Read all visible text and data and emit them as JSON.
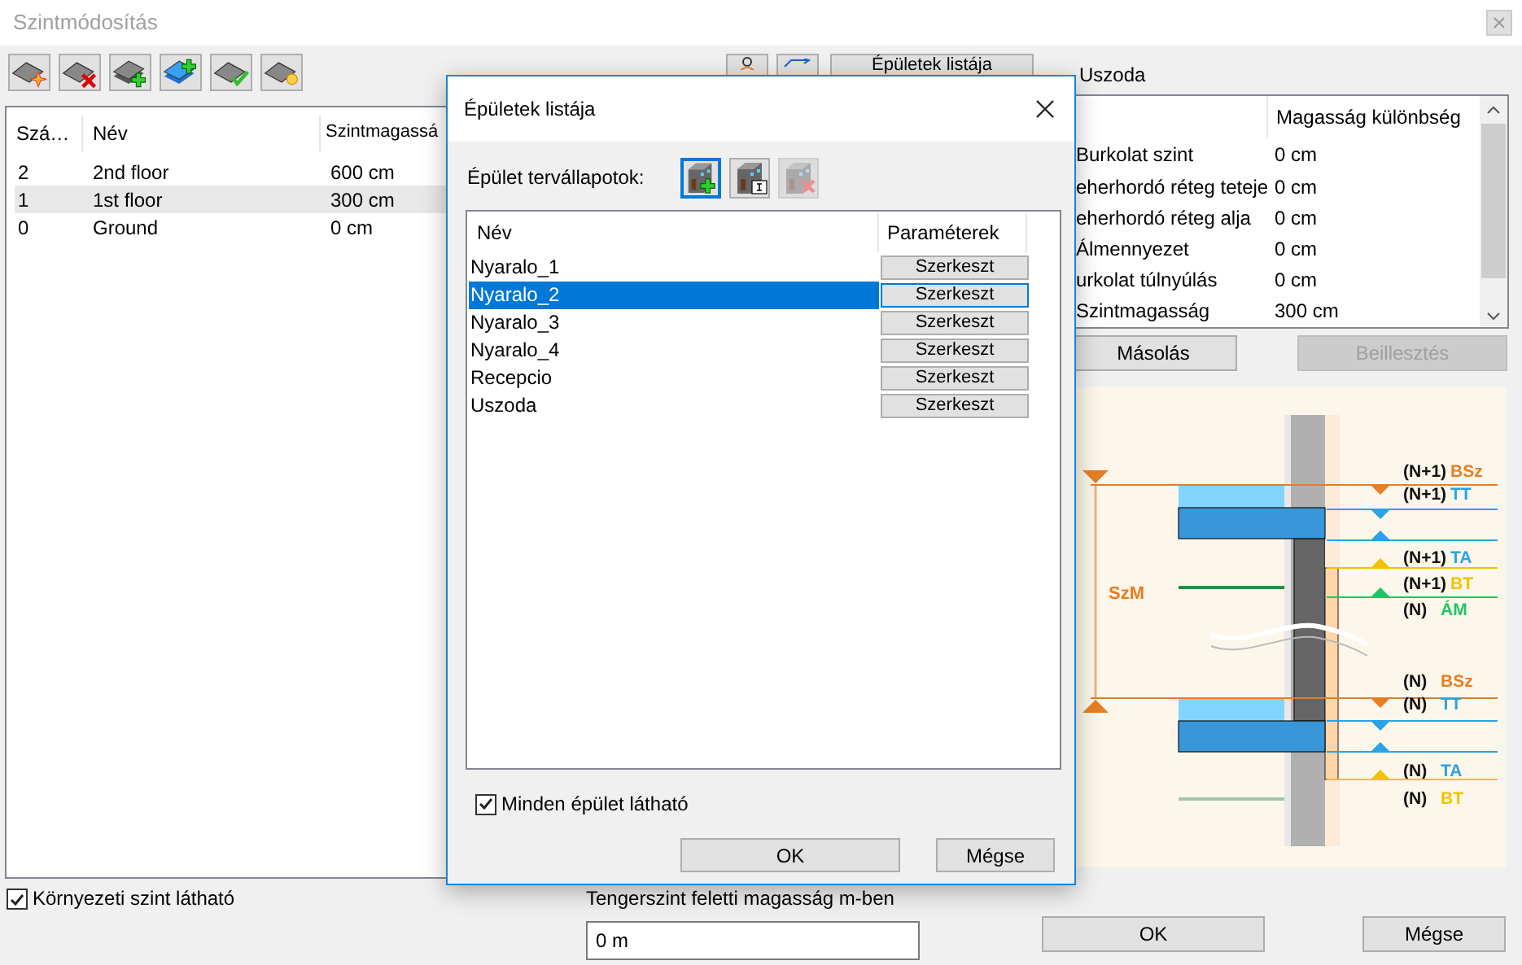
{
  "window": {
    "title": "Szintmódosítás"
  },
  "toolbar": {
    "buildings_button": "Épületek listája"
  },
  "levels_table": {
    "columns": [
      "Szá…",
      "Név",
      "Szintmagassá"
    ],
    "rows": [
      {
        "number": "2",
        "name": "2nd floor",
        "height": "600 cm",
        "selected": false
      },
      {
        "number": "1",
        "name": "1st floor",
        "height": "300 cm",
        "selected": true
      },
      {
        "number": "0",
        "name": "Ground",
        "height": "0 cm",
        "selected": false
      }
    ]
  },
  "building_label": "Uszoda",
  "properties_table": {
    "columns": [
      "Magasság különbség"
    ],
    "rows": [
      {
        "name": "Burkolat szint",
        "value": "0 cm"
      },
      {
        "name": "eherhordó réteg teteje",
        "value": "0 cm"
      },
      {
        "name": "eherhordó réteg alja",
        "value": "0 cm"
      },
      {
        "name": "Álmennyezet",
        "value": "0 cm"
      },
      {
        "name": "urkolat túlnyúlás",
        "value": "0 cm"
      },
      {
        "name": "Szintmagasság",
        "value": "300 cm"
      }
    ]
  },
  "copy_buttons": [
    {
      "label": "Másolás",
      "disabled": false
    },
    {
      "label": "Beillesztés",
      "disabled": true
    }
  ],
  "diagram": {
    "dimension_label": "SzM",
    "labels": [
      {
        "prefix": "(N+1)",
        "code": "BSz",
        "color": "#e67e22"
      },
      {
        "prefix": "(N+1)",
        "code": "TT",
        "color": "#29a3e6"
      },
      {
        "prefix": "(N+1)",
        "code": "TA",
        "color": "#29a3e6"
      },
      {
        "prefix": "(N+1)",
        "code": "BT",
        "color": "#f2c200"
      },
      {
        "prefix": "(N)",
        "code": "ÁM",
        "color": "#22c462"
      },
      {
        "prefix": "(N)",
        "code": "BSz",
        "color": "#e67e22"
      },
      {
        "prefix": "(N)",
        "code": "TT",
        "color": "#29a3e6"
      },
      {
        "prefix": "(N)",
        "code": "TA",
        "color": "#29a3e6"
      },
      {
        "prefix": "(N)",
        "code": "BT",
        "color": "#f2c200"
      }
    ]
  },
  "environment_checkbox": {
    "label": "Környezeti szint látható",
    "checked": true
  },
  "sea_level": {
    "label": "Tengerszint feletti magasság m-ben",
    "value": "0 m"
  },
  "buttons": [
    "OK",
    "Mégse"
  ],
  "dialog": {
    "title": "Épületek listája",
    "states_label": "Épület tervállapotok:",
    "state_tools": [
      {
        "selected": true,
        "disabled": false
      },
      {
        "selected": false,
        "disabled": false
      },
      {
        "selected": false,
        "disabled": true
      }
    ],
    "columns": [
      "Név",
      "Paraméterek"
    ],
    "rows": [
      {
        "name": "Nyaralo_1",
        "button": "Szerkeszt",
        "selected": false
      },
      {
        "name": "Nyaralo_2",
        "button": "Szerkeszt",
        "selected": true
      },
      {
        "name": "Nyaralo_3",
        "button": "Szerkeszt",
        "selected": false
      },
      {
        "name": "Nyaralo_4",
        "button": "Szerkeszt",
        "selected": false
      },
      {
        "name": "Recepcio",
        "button": "Szerkeszt",
        "selected": false
      },
      {
        "name": "Uszoda",
        "button": "Szerkeszt",
        "selected": false
      }
    ],
    "all_visible": {
      "label": "Minden épület látható",
      "checked": true
    },
    "buttons": [
      "OK",
      "Mégse"
    ]
  }
}
